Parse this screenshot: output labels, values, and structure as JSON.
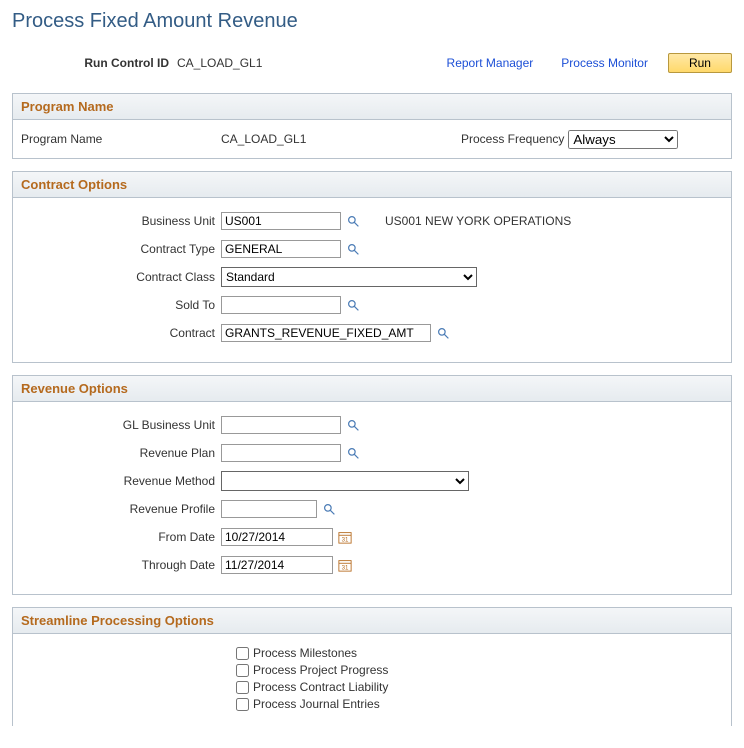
{
  "page": {
    "title": "Process Fixed Amount Revenue"
  },
  "top": {
    "runControlLabel": "Run Control ID",
    "runControlValue": "CA_LOAD_GL1",
    "reportManagerLink": "Report Manager",
    "processMonitorLink": "Process Monitor",
    "runButton": "Run"
  },
  "programSection": {
    "header": "Program Name",
    "programNameLabel": "Program Name",
    "programNameValue": "CA_LOAD_GL1",
    "processFrequencyLabel": "Process Frequency",
    "processFrequencyValue": "Always"
  },
  "contractSection": {
    "header": "Contract Options",
    "businessUnitLabel": "Business Unit",
    "businessUnitValue": "US001",
    "businessUnitDesc": "US001 NEW YORK OPERATIONS",
    "contractTypeLabel": "Contract Type",
    "contractTypeValue": "GENERAL",
    "contractClassLabel": "Contract Class",
    "contractClassValue": "Standard",
    "soldToLabel": "Sold To",
    "soldToValue": "",
    "contractLabel": "Contract",
    "contractValue": "GRANTS_REVENUE_FIXED_AMT"
  },
  "revenueSection": {
    "header": "Revenue Options",
    "glBusinessUnitLabel": "GL Business Unit",
    "glBusinessUnitValue": "",
    "revenuePlanLabel": "Revenue Plan",
    "revenuePlanValue": "",
    "revenueMethodLabel": "Revenue Method",
    "revenueMethodValue": "",
    "revenueProfileLabel": "Revenue Profile",
    "revenueProfileValue": "",
    "fromDateLabel": "From Date",
    "fromDateValue": "10/27/2014",
    "throughDateLabel": "Through Date",
    "throughDateValue": "11/27/2014"
  },
  "streamlineSection": {
    "header": "Streamline Processing Options",
    "processMilestones": "Process Milestones",
    "processProjectProgress": "Process Project Progress",
    "processContractLiability": "Process Contract Liability",
    "processJournalEntries": "Process Journal Entries"
  }
}
